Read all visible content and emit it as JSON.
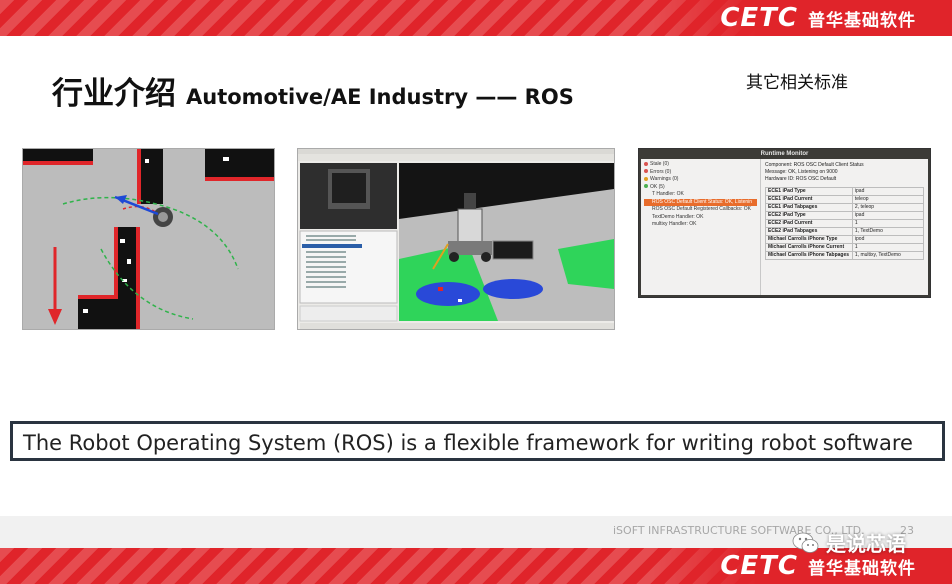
{
  "header": {
    "logo_text": "CETC",
    "brand_cn": "普华基础软件"
  },
  "title": {
    "cn": "行业介绍",
    "en": "Automotive/AE Industry —— ROS"
  },
  "side_note": "其它相关标准",
  "screenshots": {
    "rviz_map": {
      "icon": "robot-map-visualization"
    },
    "rviz_3d": {
      "icon": "ros-rviz-3d-robot"
    },
    "runtime_monitor": {
      "window_title": "Runtime Monitor",
      "tree": [
        {
          "label": "Stale (0)",
          "color": "#d9534f"
        },
        {
          "label": "Errors (0)",
          "color": "#d9534f"
        },
        {
          "label": "Warnings (0)",
          "color": "#e0a020"
        },
        {
          "label": "OK (5)",
          "color": "#4caf50"
        },
        {
          "label": "T Handler: OK",
          "color": ""
        },
        {
          "label": "ROS OSC Default Client Status: OK, Listenin",
          "color": "",
          "selected": true
        },
        {
          "label": "ROS OSC Default Registered Callbacks: OK",
          "color": ""
        },
        {
          "label": "TextDemo Handler: OK",
          "color": ""
        },
        {
          "label": "multixy Handler: OK",
          "color": ""
        }
      ],
      "component": "Component: ROS OSC Default Client Status",
      "message": "Message: OK, Listening on 9000",
      "hardware": "Hardware ID: ROS OSC Default",
      "rows": [
        [
          "ECE1 iPad Type",
          "ipad"
        ],
        [
          "ECE1 iPad Current",
          "teleop"
        ],
        [
          "ECE1 iPad Tabpages",
          "2, teleop"
        ],
        [
          "ECE2 iPad Type",
          "ipad"
        ],
        [
          "ECE2 iPad Current",
          "1"
        ],
        [
          "ECE2 iPad Tabpages",
          "1, TextDemo"
        ],
        [
          "Michael Carrolls iPhone Type",
          "ipod"
        ],
        [
          "Michael Carrolls iPhone Current",
          "1"
        ],
        [
          "Michael Carrolls iPhone Tabpages",
          "1, multixy, TextDemo"
        ]
      ]
    }
  },
  "caption": "The Robot Operating System (ROS) is a flexible framework for writing robot software",
  "footer": {
    "company": "iSOFT INFRASTRUCTURE SOFTWARE CO., LTD.",
    "page": "23",
    "watermark": "是说芯语"
  },
  "colors": {
    "brand_red": "#e0242a",
    "caption_border": "#2a3440"
  }
}
